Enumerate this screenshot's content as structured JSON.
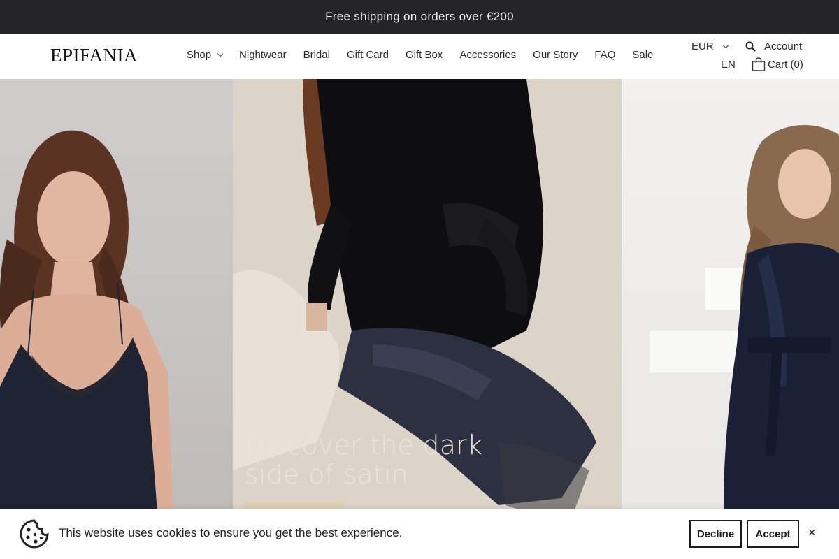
{
  "announcement": {
    "text": "Free shipping on orders over €200"
  },
  "header": {
    "logo": "EPIFANIA",
    "nav": [
      {
        "label": "Shop",
        "has_dropdown": true
      },
      {
        "label": "Nightwear"
      },
      {
        "label": "Bridal"
      },
      {
        "label": "Gift Card"
      },
      {
        "label": "Gift Box"
      },
      {
        "label": "Accessories"
      },
      {
        "label": "Our Story"
      },
      {
        "label": "FAQ"
      },
      {
        "label": "Sale"
      }
    ],
    "currency": "EUR",
    "language": "EN",
    "account_label": "Account",
    "cart_label": "Cart (0)"
  },
  "hero": {
    "headline": "Discover the dark side of satin",
    "button_color": "#ddd0b6"
  },
  "cookie_banner": {
    "message": "This website uses cookies to ensure you get the best experience.",
    "decline_label": "Decline",
    "accept_label": "Accept",
    "close_label": "×"
  },
  "icons": [
    "search-icon",
    "bag-icon",
    "cookie-icon",
    "chevron-down-icon",
    "close-icon"
  ],
  "colors": {
    "announcement_bg": "#252527",
    "headline": "#ece4d2"
  }
}
